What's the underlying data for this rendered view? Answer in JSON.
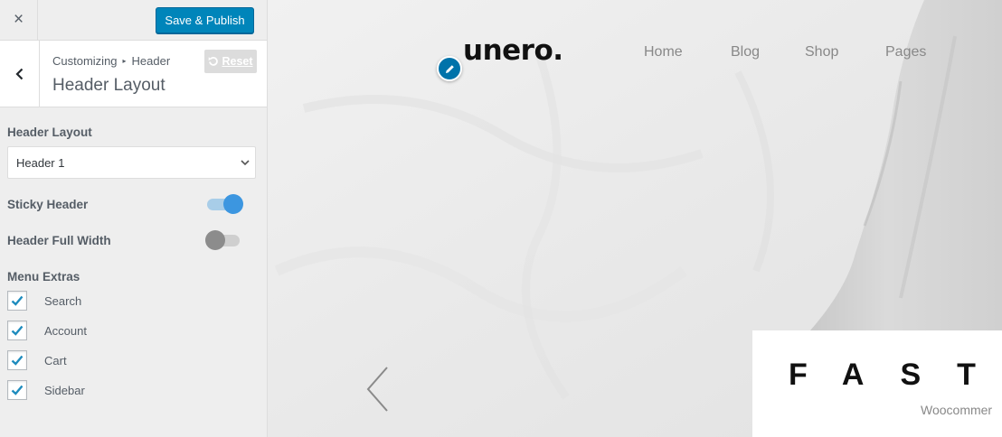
{
  "topbar": {
    "close_icon": "×",
    "publish_label": "Save & Publish"
  },
  "section": {
    "breadcrumb_root": "Customizing",
    "breadcrumb_sep": "▸",
    "breadcrumb_parent": "Header",
    "title": "Header Layout",
    "reset_label": "Reset"
  },
  "controls": {
    "layout_label": "Header Layout",
    "layout_value": "Header 1",
    "sticky_label": "Sticky Header",
    "sticky_on": true,
    "fullwidth_label": "Header Full Width",
    "fullwidth_on": false,
    "extras_label": "Menu Extras",
    "extras": [
      {
        "label": "Search",
        "checked": true
      },
      {
        "label": "Account",
        "checked": true
      },
      {
        "label": "Cart",
        "checked": true
      },
      {
        "label": "Sidebar",
        "checked": true
      }
    ]
  },
  "preview": {
    "logo": "unero.",
    "nav": [
      "Home",
      "Blog",
      "Shop",
      "Pages"
    ],
    "slide_title": "FAST",
    "slide_subtitle": "Woocommer"
  },
  "colors": {
    "accent": "#0085ba",
    "toggle_on": "#3c96e0",
    "check": "#1e8cbe"
  }
}
